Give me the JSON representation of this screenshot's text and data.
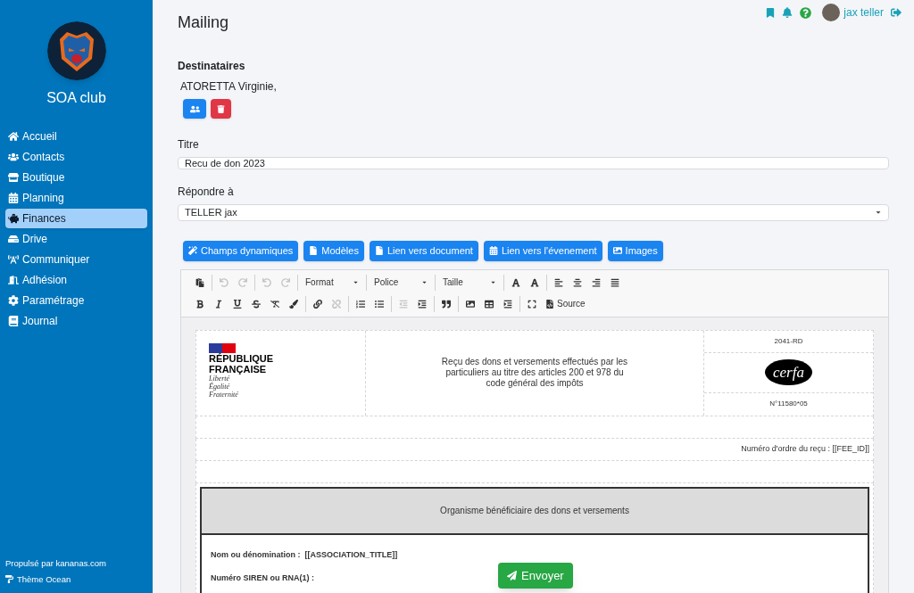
{
  "sidebar": {
    "club_name": "SOA club",
    "items": [
      {
        "label": "Accueil",
        "selected": false
      },
      {
        "label": "Contacts",
        "selected": false
      },
      {
        "label": "Boutique",
        "selected": false
      },
      {
        "label": "Planning",
        "selected": false
      },
      {
        "label": "Finances",
        "selected": true
      },
      {
        "label": "Drive",
        "selected": false
      },
      {
        "label": "Communiquer",
        "selected": false
      },
      {
        "label": "Adhésion",
        "selected": false
      },
      {
        "label": "Paramétrage",
        "selected": false
      },
      {
        "label": "Journal",
        "selected": false
      }
    ],
    "powered_by": "Propulsé par kananas.com",
    "theme": "Thème Ocean"
  },
  "topbar": {
    "user_name": "jax teller"
  },
  "page_title": "Mailing",
  "recipients": {
    "label": "Destinataires",
    "value": "ATORETTA Virginie,"
  },
  "title_field": {
    "label": "Titre",
    "value": "Recu de don 2023"
  },
  "reply_to": {
    "label": "Répondre à",
    "value": "TELLER jax"
  },
  "insert_buttons": [
    "Champs dynamiques",
    "Modèles",
    "Lien vers document",
    "Lien vers l'évenement",
    "Images"
  ],
  "toolbar": [
    [
      [
        {
          "kind": "icon",
          "disabled": false
        }
      ],
      [
        {
          "kind": "icon",
          "disabled": true
        },
        {
          "kind": "icon",
          "disabled": true
        }
      ],
      [
        {
          "kind": "icon",
          "disabled": true
        },
        {
          "kind": "icon",
          "disabled": true
        }
      ],
      [
        {
          "kind": "dropdown",
          "label": "Format"
        }
      ],
      [
        {
          "kind": "dropdown",
          "label": "Police"
        }
      ],
      [
        {
          "kind": "dropdown",
          "label": "Taille"
        }
      ],
      [
        {
          "kind": "icon",
          "disabled": false
        },
        {
          "kind": "icon",
          "disabled": false
        }
      ],
      [
        {
          "kind": "icon",
          "disabled": false
        },
        {
          "kind": "icon",
          "disabled": false
        },
        {
          "kind": "icon",
          "disabled": false
        },
        {
          "kind": "icon",
          "disabled": false
        }
      ]
    ],
    [
      [
        {
          "kind": "icon",
          "disabled": false
        },
        {
          "kind": "icon",
          "disabled": false
        },
        {
          "kind": "icon",
          "disabled": false
        },
        {
          "kind": "icon",
          "disabled": false
        },
        {
          "kind": "icon",
          "disabled": false
        },
        {
          "kind": "icon",
          "disabled": false
        }
      ],
      [
        {
          "kind": "icon",
          "disabled": false
        },
        {
          "kind": "icon",
          "disabled": true
        }
      ],
      [
        {
          "kind": "icon",
          "disabled": false
        },
        {
          "kind": "icon",
          "disabled": false
        }
      ],
      [
        {
          "kind": "icon",
          "disabled": true
        },
        {
          "kind": "icon",
          "disabled": false
        }
      ],
      [
        {
          "kind": "icon",
          "disabled": false
        }
      ],
      [
        {
          "kind": "icon",
          "disabled": false
        },
        {
          "kind": "icon",
          "disabled": false
        },
        {
          "kind": "icon",
          "disabled": false
        }
      ],
      [
        {
          "kind": "icon",
          "disabled": false
        },
        {
          "kind": "labeled",
          "label": "Source"
        }
      ]
    ]
  ],
  "document": {
    "republic": [
      "RÉPUBLIQUE",
      "FRANÇAISE"
    ],
    "motto": [
      "Liberté",
      "Égalité",
      "Fraternité"
    ],
    "heading": "Reçu des dons et versements effectués par les particuliers au titre des articles 200 et 978 du code général des impôts",
    "form_code": "2041-RD",
    "cerfa": "cerfa",
    "cerfa_number": "N°11580*05",
    "receipt_number": "Numéro d'ordre du reçu : [[FEE_ID]]",
    "section_title": "Organisme bénéficiaire des dons et versements",
    "fields": [
      "Nom ou dénomination :  [[ASSOCIATION_TITLE]]",
      "Numéro SIREN ou RNA(1) :"
    ]
  },
  "send_button": "Envoyer"
}
